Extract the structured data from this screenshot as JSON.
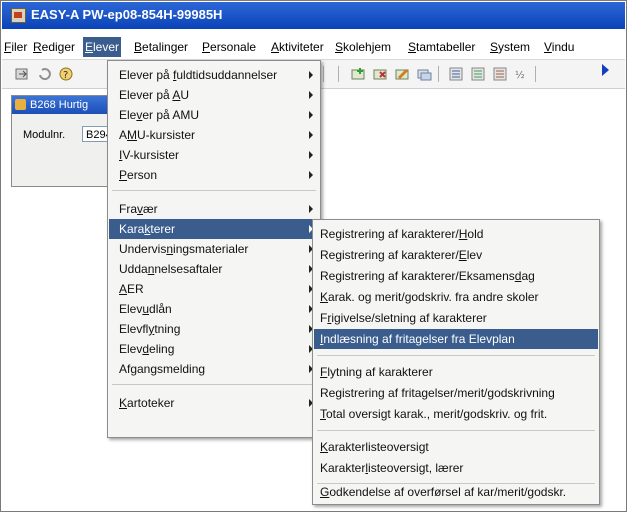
{
  "window": {
    "title": "EASY-A PW-ep08-854H-99985H"
  },
  "menubar": {
    "items": [
      {
        "pre": "",
        "u": "F",
        "post": "iler"
      },
      {
        "pre": "",
        "u": "R",
        "post": "ediger"
      },
      {
        "pre": "",
        "u": "E",
        "post": "lever"
      },
      {
        "pre": "",
        "u": "B",
        "post": "etalinger"
      },
      {
        "pre": "",
        "u": "P",
        "post": "ersonale"
      },
      {
        "pre": "",
        "u": "A",
        "post": "ktiviteter"
      },
      {
        "pre": "",
        "u": "S",
        "post": "kolehjem"
      },
      {
        "pre": "",
        "u": "S",
        "post": "tamtabeller"
      },
      {
        "pre": "",
        "u": "S",
        "post": "ystem"
      },
      {
        "pre": "",
        "u": "V",
        "post": "indu"
      }
    ]
  },
  "subwindow": {
    "title": "B268 Hurtig",
    "field_label": "Modulnr.",
    "field_value": "B294"
  },
  "elever_menu": {
    "items": [
      {
        "pre": "Elever på ",
        "u": "f",
        "post": "uldtidsuddannelser"
      },
      {
        "pre": "Elever på ",
        "u": "A",
        "post": "U"
      },
      {
        "pre": "Ele",
        "u": "v",
        "post": "er på AMU"
      },
      {
        "pre": "A",
        "u": "M",
        "post": "U-kursister"
      },
      {
        "pre": "",
        "u": "I",
        "post": "V-kursister"
      },
      {
        "pre": "",
        "u": "P",
        "post": "erson"
      },
      {
        "pre": "Fra",
        "u": "v",
        "post": "ær"
      },
      {
        "pre": "Kara",
        "u": "k",
        "post": "terer"
      },
      {
        "pre": "Undervis",
        "u": "n",
        "post": "ingsmaterialer"
      },
      {
        "pre": "Udda",
        "u": "n",
        "post": "nelsesaftaler"
      },
      {
        "pre": "",
        "u": "A",
        "post": "ER"
      },
      {
        "pre": "Elev",
        "u": "u",
        "post": "dlån"
      },
      {
        "pre": "Elevfl",
        "u": "y",
        "post": "tning"
      },
      {
        "pre": "Elev",
        "u": "d",
        "post": "eling"
      },
      {
        "pre": "Afgangsmelding",
        "u": "",
        "post": ""
      },
      {
        "pre": "",
        "u": "K",
        "post": "artoteker"
      }
    ]
  },
  "karakterer_menu": {
    "items": [
      {
        "pre": "Registrering af karakterer/",
        "u": "H",
        "post": "old"
      },
      {
        "pre": "Registrering af karakterer/",
        "u": "E",
        "post": "lev"
      },
      {
        "pre": "Registrering af karakterer/Eksamens",
        "u": "d",
        "post": "ag"
      },
      {
        "pre": "",
        "u": "K",
        "post": "arak. og merit/godskriv. fra andre skoler"
      },
      {
        "pre": "F",
        "u": "r",
        "post": "igivelse/sletning af karakterer"
      },
      {
        "pre": "",
        "u": "I",
        "post": "ndlæsning af fritagelser fra Elevplan"
      },
      {
        "pre": "",
        "u": "F",
        "post": "lytning af karakterer"
      },
      {
        "pre": "Registrering af fritagelser/merit/godskrivning",
        "u": "",
        "post": ""
      },
      {
        "pre": "",
        "u": "T",
        "post": "otal oversigt karak., merit/godskriv. og frit."
      },
      {
        "pre": "",
        "u": "K",
        "post": "arakterlisteoversigt"
      },
      {
        "pre": "Karakter",
        "u": "l",
        "post": "isteoversigt, lærer"
      },
      {
        "pre": "",
        "u": "G",
        "post": "odkendelse af overførsel af kar/merit/godskr."
      }
    ]
  }
}
